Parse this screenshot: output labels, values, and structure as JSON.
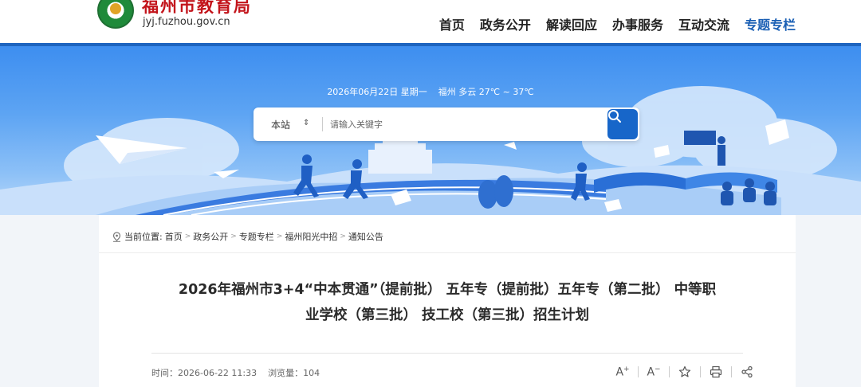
{
  "header": {
    "site_name": "福州市教育局",
    "site_domain": "jyj.fuzhou.gov.cn",
    "nav": [
      {
        "label": "首页",
        "active": false
      },
      {
        "label": "政务公开",
        "active": false
      },
      {
        "label": "解读回应",
        "active": false
      },
      {
        "label": "办事服务",
        "active": false
      },
      {
        "label": "互动交流",
        "active": false
      },
      {
        "label": "专题专栏",
        "active": true
      }
    ]
  },
  "banner": {
    "weather": "2026年06月22日 星期一    福州 多云 27℃ ~ 37℃",
    "search": {
      "scope": "本站",
      "placeholder": "请输入关键字",
      "button_icon": "search-icon"
    }
  },
  "breadcrumb": {
    "prefix": "当前位置:",
    "items": [
      "首页",
      "政务公开",
      "专题专栏",
      "福州阳光中招",
      "通知公告"
    ]
  },
  "article": {
    "title_line1": "2026年福州市3+4“中本贯通”（提前批） 五年专（提前批）五年专（第二批） 中等职",
    "title_line2": "业学校（第三批） 技工校（第三批）招生计划",
    "meta": "时间：2026-06-22 11:33    浏览量：104",
    "tools": {
      "font_increase": "A",
      "font_decrease": "A"
    }
  },
  "colors": {
    "accent": "#1a5fb4",
    "brand_red": "#c3141b",
    "header_line": "#1d64bf"
  }
}
